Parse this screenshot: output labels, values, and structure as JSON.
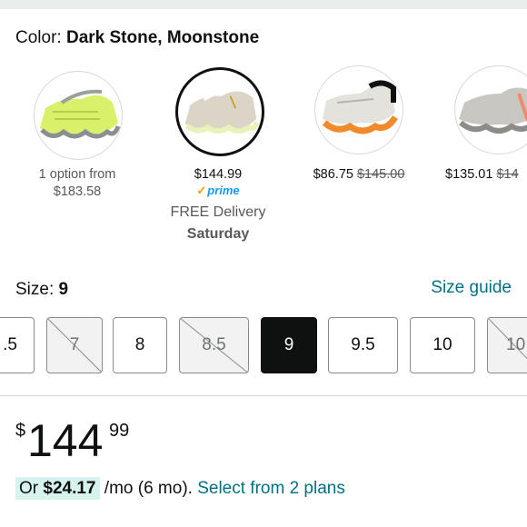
{
  "color": {
    "label": "Color:",
    "value": "Dark Stone, Moonstone"
  },
  "swatches": [
    {
      "line1": "1 option from",
      "line2": "$183.58",
      "icon": "shoe-lime-icon",
      "accent": "#d8f06a"
    },
    {
      "price": "$144.99",
      "prime": "prime",
      "delivery": "FREE Delivery",
      "day": "Saturday",
      "icon": "shoe-stone-icon",
      "accent": "#e9f2b8"
    },
    {
      "price": "$86.75",
      "was": "$145.00",
      "icon": "shoe-orange-icon",
      "accent": "#f08a2b"
    },
    {
      "price": "$135.01",
      "was": "$14",
      "icon": "shoe-grey-icon",
      "accent": "#c9c7c2"
    }
  ],
  "size": {
    "label": "Size:",
    "value": "9",
    "guide": "Size guide"
  },
  "sizes": [
    {
      "label": ".5",
      "available": true,
      "selected": false
    },
    {
      "label": "7",
      "available": false,
      "selected": false
    },
    {
      "label": "8",
      "available": true,
      "selected": false
    },
    {
      "label": "8.5",
      "available": false,
      "selected": false
    },
    {
      "label": "9",
      "available": true,
      "selected": true
    },
    {
      "label": "9.5",
      "available": true,
      "selected": false
    },
    {
      "label": "10",
      "available": true,
      "selected": false
    },
    {
      "label": "10",
      "available": false,
      "selected": false
    }
  ],
  "price": {
    "symbol": "$",
    "whole": "144",
    "fraction": "99"
  },
  "installment": {
    "prefix": "Or ",
    "amount": "$24.17",
    "term": " /mo (6 mo).",
    "link": "Select from 2 plans"
  },
  "colors": {
    "link": "#007185",
    "prime": "#1399ff",
    "chip": "#d6f4ed",
    "selected": "#0f1111"
  }
}
